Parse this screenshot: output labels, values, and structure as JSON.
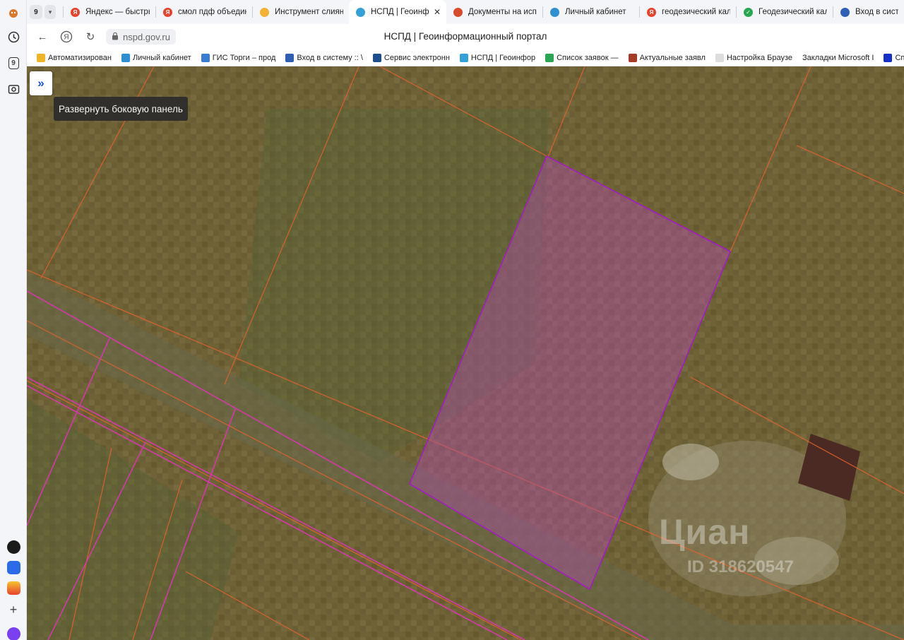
{
  "browser": {
    "tab_counter": "9",
    "tabs": [
      {
        "title": "Яндекс — быстрый",
        "fav_color": "#e8412c",
        "fav_glyph": "Я"
      },
      {
        "title": "смол пдф объедини",
        "fav_color": "#e8412c",
        "fav_glyph": "Я"
      },
      {
        "title": "Инструмент слияни",
        "fav_color": "#f2b233",
        "fav_glyph": ""
      },
      {
        "title": "НСПД | Геоинфор",
        "fav_color": "#33a0d8",
        "fav_glyph": "",
        "active": true
      },
      {
        "title": "Документы на испо",
        "fav_color": "#d84a2c",
        "fav_glyph": ""
      },
      {
        "title": "Личный кабинет",
        "fav_color": "#2f8fd0",
        "fav_glyph": ""
      },
      {
        "title": "геодезический каль",
        "fav_color": "#e8412c",
        "fav_glyph": "Я"
      },
      {
        "title": "Геодезический каль",
        "fav_color": "#2aa552",
        "fav_glyph": "✓"
      },
      {
        "title": "Вход в систем",
        "fav_color": "#2e5fb5",
        "fav_glyph": ""
      }
    ],
    "close_glyph": "✕",
    "address": {
      "url": "nspd.gov.ru",
      "page_title": "НСПД | Геоинформационный портал"
    },
    "bookmarks": [
      {
        "label": "Автоматизирован",
        "color": "#f0b429"
      },
      {
        "label": "Личный кабинет",
        "color": "#2f8fd0"
      },
      {
        "label": "ГИС Торги – прод",
        "color": "#3a7bd5"
      },
      {
        "label": "Вход в систему :: \\",
        "color": "#2e5fb5"
      },
      {
        "label": "Сервис электронн",
        "color": "#1f4e8c"
      },
      {
        "label": "НСПД | Геоинфор",
        "color": "#33a0d8"
      },
      {
        "label": "Список заявок —",
        "color": "#2aa552"
      },
      {
        "label": "Актуальные заявл",
        "color": "#a43a2a"
      },
      {
        "label": "Настройка Браузе",
        "color": "#dddddd"
      },
      {
        "label": "Закладки Microsoft I",
        "color": ""
      },
      {
        "label": "Спутников",
        "color": "#1530c8"
      }
    ]
  },
  "map": {
    "expand_button_glyph": "»",
    "tooltip": "Развернуть боковую панель",
    "watermark_logo": "Циан",
    "watermark_id": "ID 318620547"
  },
  "colors": {
    "parcel_border": "#e2622f",
    "selected_fill": "#b04ea8",
    "selected_stroke": "#a21cc2",
    "road_line": "#d23aa8"
  }
}
